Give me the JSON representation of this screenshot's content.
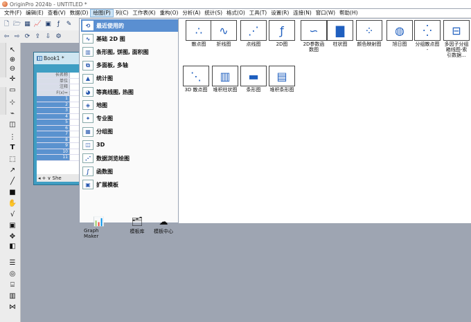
{
  "window": {
    "title": "OriginPro 2024b - UNTITLED *"
  },
  "menu": [
    "文件(F)",
    "编辑(E)",
    "查看(V)",
    "数据(D)",
    "绘图(P)",
    "列(C)",
    "工作表(K)",
    "重构(O)",
    "分析(A)",
    "统计(S)",
    "格式(O)",
    "工具(T)",
    "设置(R)",
    "连接(N)",
    "窗口(W)",
    "帮助(H)"
  ],
  "book": {
    "title": "Book1 *",
    "header_rows": [
      "长名称",
      "单位",
      "注释",
      "F(x)="
    ],
    "rows": [
      "1",
      "2",
      "3",
      "4",
      "5",
      "6",
      "7",
      "8",
      "9",
      "10",
      "11"
    ],
    "sheet_tab": "She"
  },
  "plot_menu": {
    "items": [
      "最近使用的",
      "基础 2D 图",
      "条形图, 饼图, 面积图",
      "多面板, 多轴",
      "统计图",
      "等高线图, 热图",
      "地图",
      "专业图",
      "分组图",
      "3D",
      "数据浏览绘图",
      "函数图",
      "扩展模板"
    ],
    "bottom": [
      "Graph Maker",
      "模板库",
      "模板中心"
    ]
  },
  "gallery": {
    "items": [
      "散点图",
      "折线图",
      "点线图",
      "2D图",
      "2D参数函\n数图",
      "柱状图",
      "颜色映射图",
      "旭日图",
      "分组散点图\n-",
      "多因子分组\n箱线图-索\n引数据...",
      "3D 散点图",
      "堆积柱状图",
      "条形图",
      "堆积条形图"
    ]
  },
  "colors": {
    "highlight": "#5a8fd1",
    "book_frame": "#3f9ec3",
    "workspace": "#9ea5b2"
  }
}
